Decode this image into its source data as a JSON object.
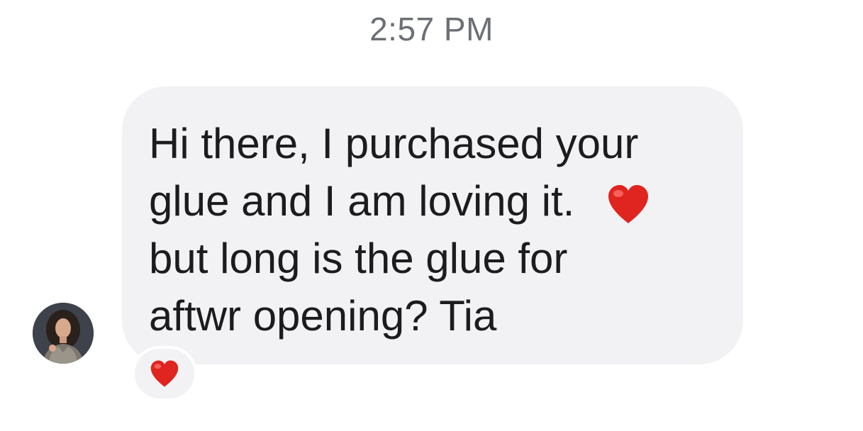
{
  "conversation": {
    "timestamp": "2:57 PM"
  },
  "message": {
    "lines": [
      "Hi there, I purchased your",
      "glue and I am loving it.",
      "but long is the glue for",
      "aftwr opening? Tia"
    ],
    "inline_emoji": "red-heart",
    "reaction": "red-heart"
  },
  "colors": {
    "bubble": "#f2f2f4",
    "text": "#1c1c1e",
    "timestamp": "#6c6f75",
    "heart": "#e0241f"
  }
}
